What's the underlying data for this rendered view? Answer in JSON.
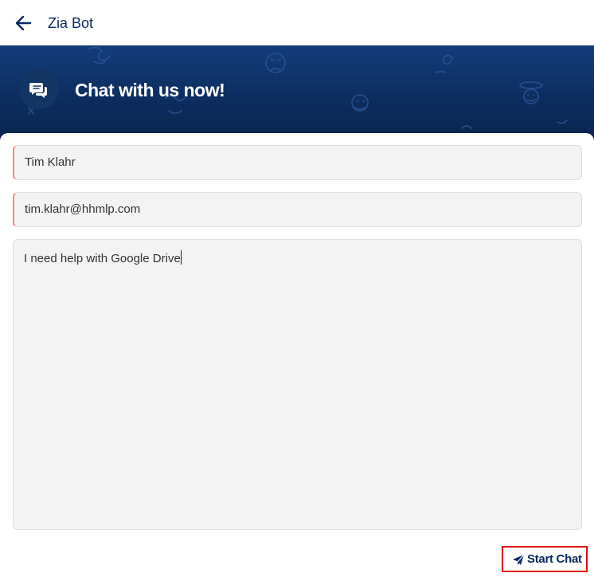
{
  "header": {
    "back_icon": "arrow-left-icon",
    "title": "Zia Bot"
  },
  "banner": {
    "icon": "chat-bubbles-icon",
    "title": "Chat with us now!"
  },
  "form": {
    "name_value": "Tim Klahr",
    "email_value": "tim.klahr@hhmlp.com",
    "message_value": "I need help with Google Drive"
  },
  "actions": {
    "start_chat_icon": "paper-plane-icon",
    "start_chat_label": "Start Chat"
  },
  "colors": {
    "brand_navy": "#0b2a64",
    "banner_top": "#133d7a",
    "banner_bottom": "#0b2550",
    "required_marker": "#f28b82",
    "highlight_border": "#e00000"
  }
}
